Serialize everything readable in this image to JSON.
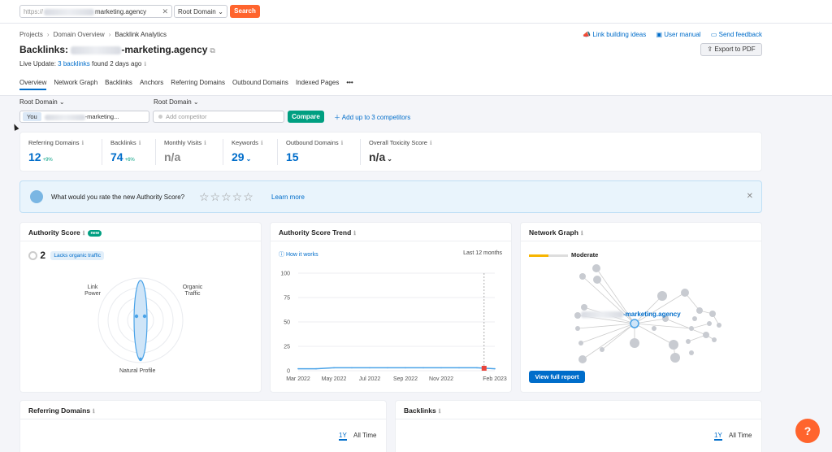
{
  "topbar": {
    "url_prefix": "https://",
    "url_domain": "marketing.agency",
    "domain_type": "Root Domain",
    "search_label": "Search"
  },
  "breadcrumbs": [
    "Projects",
    "Domain Overview",
    "Backlink Analytics"
  ],
  "page": {
    "title_prefix": "Backlinks:",
    "title_domain": "-marketing.agency",
    "live_update_prefix": "Live Update:",
    "live_update_link": "3 backlinks",
    "live_update_suffix": "found 2 days ago"
  },
  "header_links": {
    "link_building": "Link building ideas",
    "user_manual": "User manual",
    "feedback": "Send feedback",
    "export": "Export to PDF"
  },
  "tabs": [
    "Overview",
    "Network Graph",
    "Backlinks",
    "Anchors",
    "Referring Domains",
    "Outbound Domains",
    "Indexed Pages",
    "•••"
  ],
  "controls": {
    "left_scope": "Root Domain",
    "right_scope": "Root Domain",
    "you_tag": "You",
    "you_domain": "-marketing...",
    "competitor_placeholder": "Add competitor",
    "compare_label": "Compare",
    "add_competitors": "Add up to 3 competitors"
  },
  "metrics": [
    {
      "label": "Referring Domains",
      "value": "12",
      "change": "+9%"
    },
    {
      "label": "Backlinks",
      "value": "74",
      "change": "+6%"
    },
    {
      "label": "Monthly Visits",
      "value": "n/a",
      "change": ""
    },
    {
      "label": "Keywords",
      "value": "29",
      "change": ""
    },
    {
      "label": "Outbound Domains",
      "value": "15",
      "change": ""
    },
    {
      "label": "Overall Toxicity Score",
      "value": "n/a",
      "change": ""
    }
  ],
  "rating": {
    "question": "What would you rate the new Authority Score?",
    "learn_more": "Learn more"
  },
  "authority_card": {
    "title": "Authority Score",
    "badge": "new",
    "score": "2",
    "tag": "Lacks organic traffic",
    "labels": {
      "link_power": "Link Power",
      "organic_traffic": "Organic Traffic",
      "natural_profile": "Natural Profile"
    }
  },
  "trend_card": {
    "title": "Authority Score Trend",
    "how_it_works": "How it works",
    "period": "Last 12 months",
    "y_ticks": [
      "100",
      "75",
      "50",
      "25",
      "0"
    ],
    "x_ticks": [
      "Mar 2022",
      "May 2022",
      "Jul 2022",
      "Sep 2022",
      "Nov 2022",
      "Feb 2023"
    ]
  },
  "network_card": {
    "title": "Network Graph",
    "level": "Moderate",
    "node_label": "-marketing.agency",
    "view_report": "View full report"
  },
  "bottom": {
    "ref_domains_title": "Referring Domains",
    "backlinks_title": "Backlinks",
    "range_1y": "1Y",
    "range_all": "All Time"
  },
  "help_label": "?",
  "chart_data": {
    "type": "line",
    "x": [
      "Mar 2022",
      "Apr 2022",
      "May 2022",
      "Jun 2022",
      "Jul 2022",
      "Aug 2022",
      "Sep 2022",
      "Oct 2022",
      "Nov 2022",
      "Dec 2022",
      "Jan 2023",
      "Feb 2023"
    ],
    "series": [
      {
        "values": [
          2,
          2,
          3,
          3,
          3,
          3,
          3,
          3,
          3,
          3,
          3,
          2
        ]
      }
    ],
    "ylim": [
      0,
      100
    ],
    "y_ticks": [
      0,
      25,
      50,
      75,
      100
    ],
    "grid": true
  }
}
